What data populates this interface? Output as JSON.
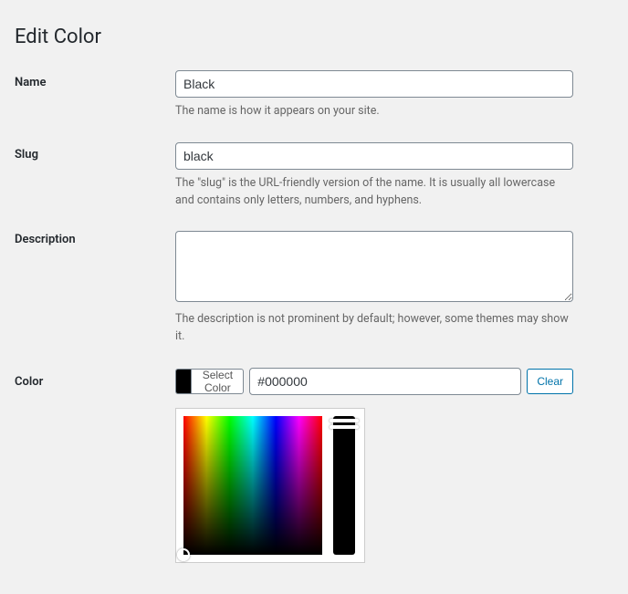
{
  "page": {
    "title": "Edit Color"
  },
  "fields": {
    "name": {
      "label": "Name",
      "value": "Black",
      "description": "The name is how it appears on your site."
    },
    "slug": {
      "label": "Slug",
      "value": "black",
      "description": "The \"slug\" is the URL-friendly version of the name. It is usually all lowercase and contains only letters, numbers, and hyphens."
    },
    "description": {
      "label": "Description",
      "value": "",
      "description": "The description is not prominent by default; however, some themes may show it."
    },
    "color": {
      "label": "Color",
      "select_label": "Select Color",
      "hex": "#000000",
      "clear_label": "Clear",
      "swatch_color": "#000000"
    }
  }
}
